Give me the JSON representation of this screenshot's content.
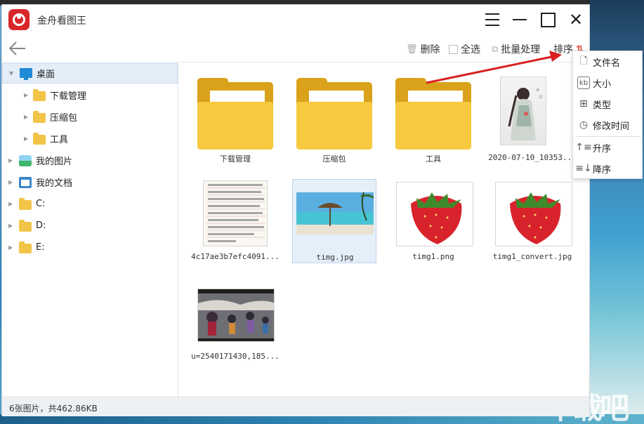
{
  "app": {
    "title": "金舟看图王"
  },
  "toolbar": {
    "delete_label": "删除",
    "select_all_label": "全选",
    "batch_label": "批量处理",
    "sort_label": "排序"
  },
  "sidebar": {
    "items": [
      {
        "label": "桌面",
        "icon": "desktop-icon"
      },
      {
        "label": "下载管理",
        "icon": "folder-icon"
      },
      {
        "label": "压缩包",
        "icon": "folder-icon"
      },
      {
        "label": "工具",
        "icon": "folder-icon"
      },
      {
        "label": "我的图片",
        "icon": "pictures-icon"
      },
      {
        "label": "我的文档",
        "icon": "documents-icon"
      },
      {
        "label": "C:",
        "icon": "folder-icon"
      },
      {
        "label": "D:",
        "icon": "folder-icon"
      },
      {
        "label": "E:",
        "icon": "folder-icon"
      }
    ]
  },
  "files": [
    {
      "name": "下载管理",
      "kind": "folder"
    },
    {
      "name": "压缩包",
      "kind": "folder"
    },
    {
      "name": "工具",
      "kind": "folder"
    },
    {
      "name": "2020-07-10_10353...",
      "kind": "image"
    },
    {
      "name": "4c17ae3b7efc4091...",
      "kind": "image"
    },
    {
      "name": "timg.jpg",
      "kind": "image"
    },
    {
      "name": "timg1.png",
      "kind": "image"
    },
    {
      "name": "timg1_convert.jpg",
      "kind": "image"
    },
    {
      "name": "u=2540171430,185...",
      "kind": "image"
    }
  ],
  "sort_menu": {
    "items": [
      {
        "label": "文件名",
        "icon": "file-icon"
      },
      {
        "label": "大小",
        "icon": "kb-icon"
      },
      {
        "label": "类型",
        "icon": "grid-icon"
      },
      {
        "label": "修改时间",
        "icon": "clock-icon"
      },
      {
        "label": "升序",
        "icon": "ascending-icon"
      },
      {
        "label": "降序",
        "icon": "descending-icon"
      }
    ]
  },
  "status": {
    "text": "6张图片，共462.86KB"
  },
  "watermark": {
    "text": "下载吧"
  },
  "colors": {
    "accent_red": "#d9262b",
    "folder_yellow": "#f7c93e",
    "selection": "#e4eef8"
  }
}
